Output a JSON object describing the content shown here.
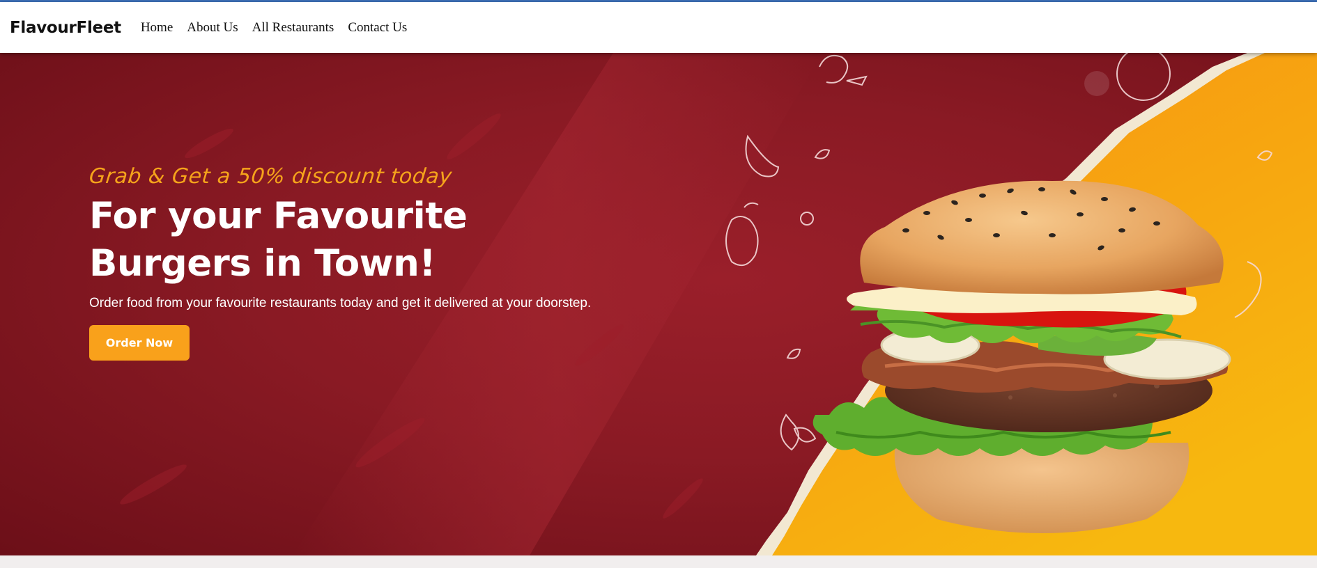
{
  "nav": {
    "brand": "FlavourFleet",
    "links": [
      "Home",
      "About Us",
      "All Restaurants",
      "Contact Us"
    ]
  },
  "hero": {
    "tagline": "Grab & Get a 50% discount today",
    "headline_line1": "For your Favourite",
    "headline_line2": "Burgers in Town!",
    "subtext": "Order food from your favourite restaurants today and get it delivered at your doorstep.",
    "cta_label": "Order Now",
    "image": "burger-illustration"
  },
  "colors": {
    "nav_bg": "#ffffff",
    "hero_red": "#8a1a24",
    "hero_orange": "#f59a0c",
    "accent": "#f9a11b",
    "topline": "#3d6fb6"
  }
}
